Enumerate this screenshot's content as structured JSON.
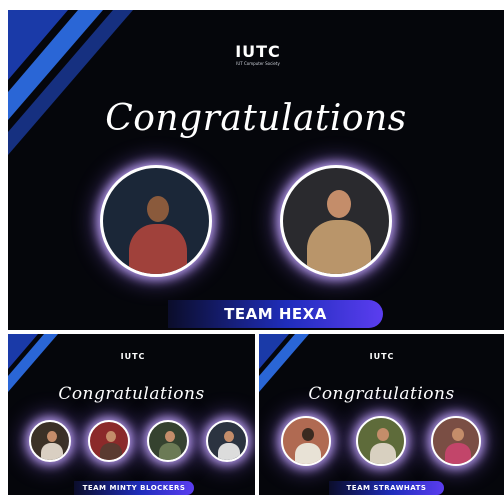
{
  "logo": {
    "text": "IUTC",
    "tagline": "IUT Computer Society"
  },
  "panels": [
    {
      "title": "Congratulations",
      "team": "TEAM HEXA"
    },
    {
      "title": "Congratulations",
      "team": "TEAM MINTY BLOCKERS"
    },
    {
      "title": "Congratulations",
      "team": "TEAM STRAWHATS"
    }
  ],
  "colors": {
    "background": "#05060b",
    "accent_red": "#e23b3b",
    "banner_blue": "#1f2dbb",
    "glow": "#c8aaff"
  }
}
